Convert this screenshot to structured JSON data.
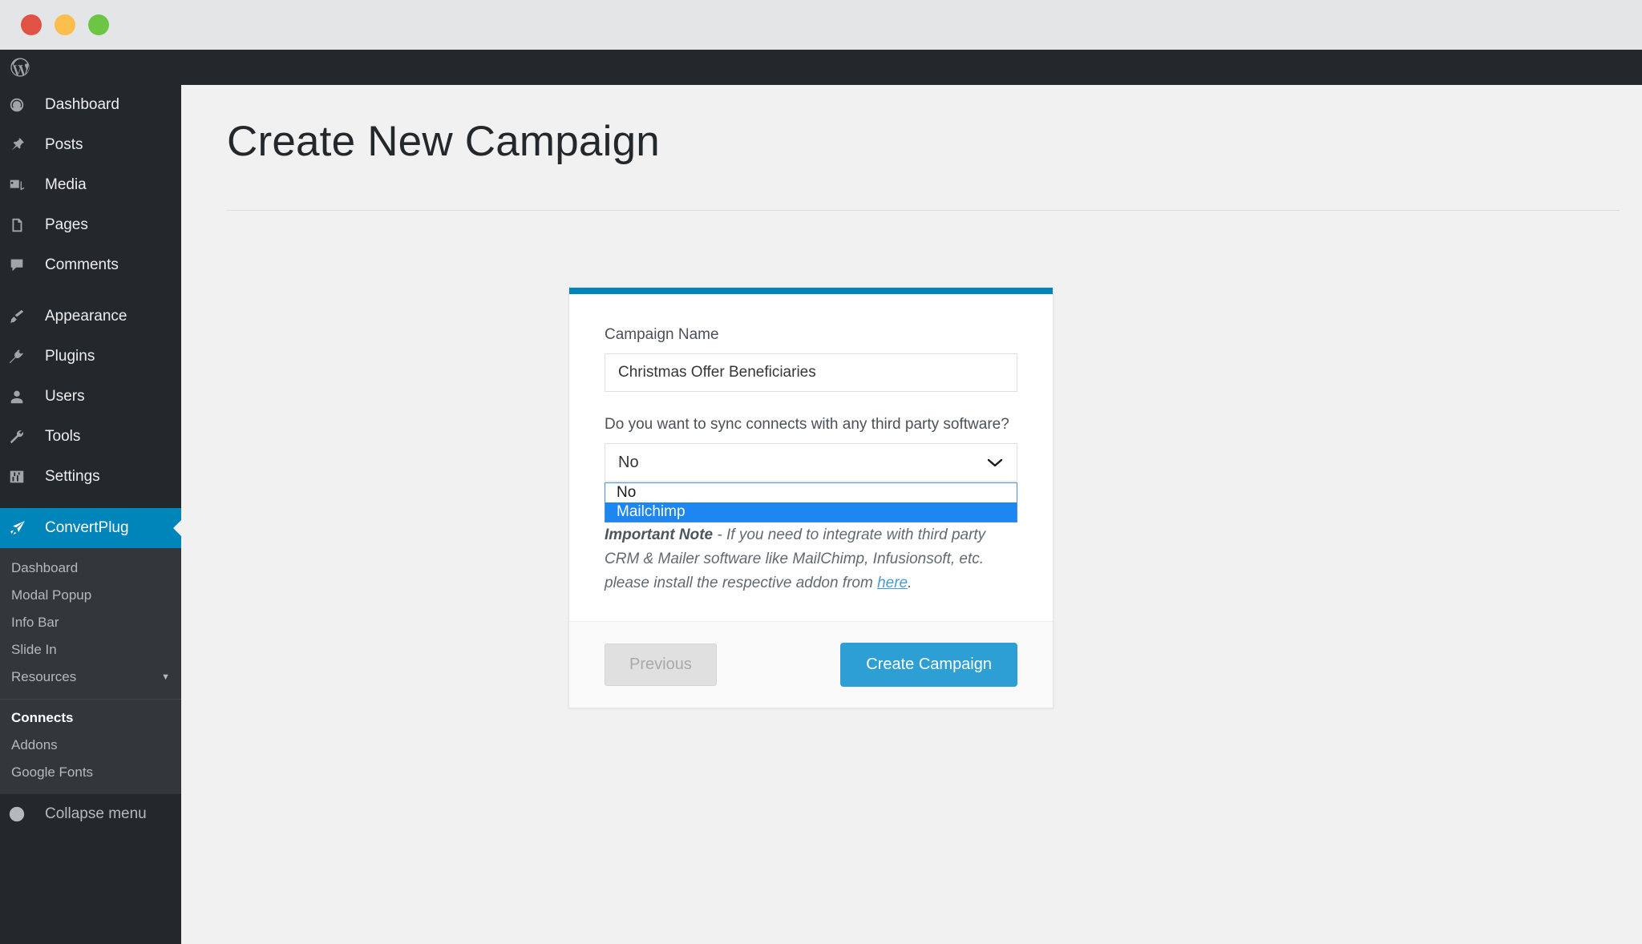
{
  "window": {
    "traffic_lights": [
      "close",
      "minimize",
      "maximize"
    ],
    "colors": {
      "close": "#e05243",
      "minimize": "#fbbd4b",
      "maximize": "#6cc644"
    }
  },
  "adminbar": {
    "logo": "wordpress-logo"
  },
  "sidebar": {
    "items": [
      {
        "label": "Dashboard",
        "icon": "dashboard-icon",
        "current": false
      },
      {
        "label": "Posts",
        "icon": "pin-icon",
        "current": false
      },
      {
        "label": "Media",
        "icon": "media-icon",
        "current": false
      },
      {
        "label": "Pages",
        "icon": "pages-icon",
        "current": false
      },
      {
        "label": "Comments",
        "icon": "comment-icon",
        "current": false
      },
      {
        "label": "Appearance",
        "icon": "brush-icon",
        "current": false
      },
      {
        "label": "Plugins",
        "icon": "plugin-icon",
        "current": false
      },
      {
        "label": "Users",
        "icon": "user-icon",
        "current": false
      },
      {
        "label": "Tools",
        "icon": "wrench-icon",
        "current": false
      },
      {
        "label": "Settings",
        "icon": "settings-icon",
        "current": false
      },
      {
        "label": "ConvertPlug",
        "icon": "convertplug-icon",
        "current": true
      }
    ],
    "submenu": [
      {
        "label": "Dashboard",
        "active": false,
        "caret": false
      },
      {
        "label": "Modal Popup",
        "active": false,
        "caret": false
      },
      {
        "label": "Info Bar",
        "active": false,
        "caret": false
      },
      {
        "label": "Slide In",
        "active": false,
        "caret": false
      },
      {
        "label": "Resources",
        "active": false,
        "caret": true
      },
      {
        "label": "Connects",
        "active": true,
        "caret": false
      },
      {
        "label": "Addons",
        "active": false,
        "caret": false
      },
      {
        "label": "Google Fonts",
        "active": false,
        "caret": false
      }
    ],
    "collapse": {
      "label": "Collapse menu",
      "icon": "collapse-arrow-icon"
    },
    "accent_color": "#0085ba"
  },
  "main": {
    "page_title": "Create New Campaign",
    "card": {
      "accent_color": "#0085ba",
      "campaign_name": {
        "label": "Campaign Name",
        "value": "Christmas Offer Beneficiaries",
        "placeholder": "Campaign Name"
      },
      "sync": {
        "label": "Do you want to sync connects with any third party software?",
        "selected": "No",
        "options": [
          {
            "label": "No",
            "selected": false
          },
          {
            "label": "Mailchimp",
            "selected": true
          }
        ],
        "highlight_color": "#1e86f0",
        "chevron": "chevron-down-icon"
      },
      "note": {
        "strong": "Important Note",
        "text_before": " - If you need to integrate with third party CRM & Mailer software like MailChimp, Infusionsoft, etc. please install the respective addon from ",
        "link": "here",
        "text_after": "."
      },
      "footer": {
        "previous_label": "Previous",
        "create_label": "Create Campaign",
        "create_color": "#2e9fd4"
      }
    }
  }
}
